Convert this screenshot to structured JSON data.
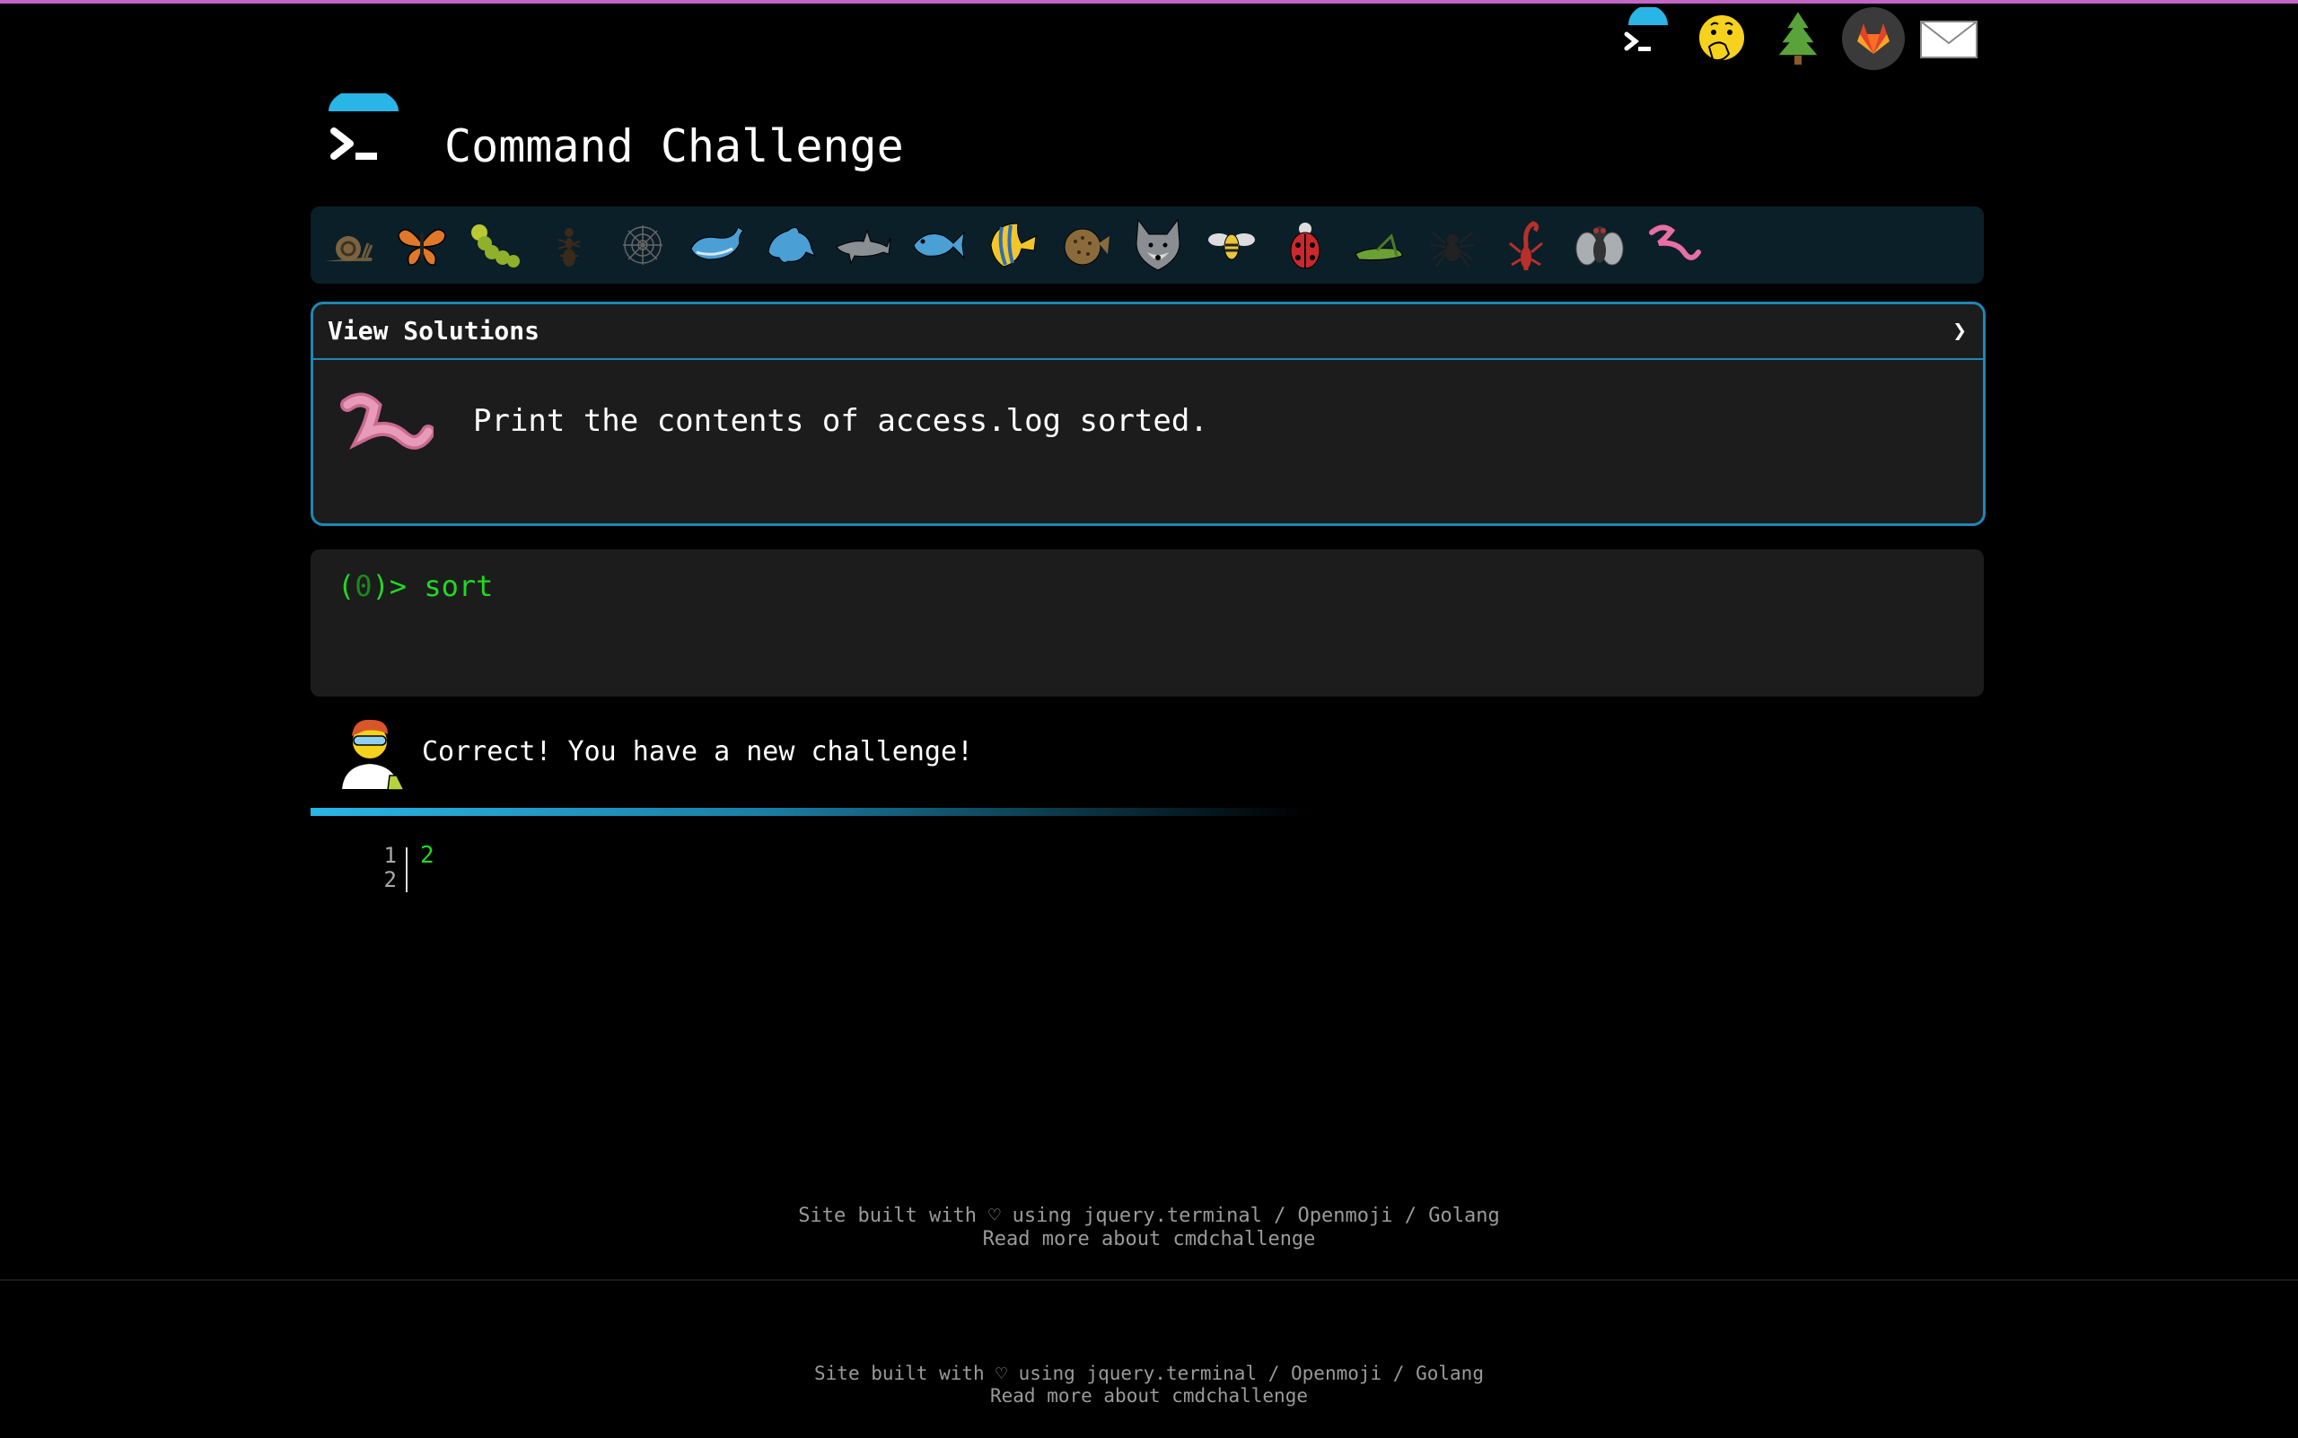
{
  "header": {
    "title": "Command Challenge",
    "logo_icon": "terminal-prompt-icon"
  },
  "top_icons": [
    "terminal-icon",
    "face-with-hand-over-mouth-icon",
    "evergreen-tree-icon",
    "gitlab-icon",
    "envelope-icon"
  ],
  "level_icons": [
    "snail",
    "butterfly",
    "caterpillar",
    "ant",
    "spider-web",
    "whale",
    "dolphin",
    "shark",
    "fish",
    "tropical-fish",
    "blowfish",
    "wolf",
    "bee",
    "ladybug",
    "cricket",
    "spider",
    "scorpion",
    "fly",
    "worm"
  ],
  "challenge": {
    "view_solutions_label": "View Solutions",
    "chevron": "❯",
    "task": "Print the contents of access.log sorted."
  },
  "terminal": {
    "prompt_open": "(",
    "prompt_code": "0",
    "prompt_close": ")>",
    "command": "sort"
  },
  "result": {
    "message": "Correct! You have a new challenge!"
  },
  "output": {
    "line_numbers": [
      "1",
      "2"
    ],
    "lines": [
      "2"
    ]
  },
  "footer": {
    "line1": "Site built with ♡ using jquery.terminal / Openmoji / Golang",
    "line2": "Read more about cmdchallenge"
  },
  "footer_bottom": {
    "line1": "Site built with ♡ using jquery.terminal / Openmoji / Golang",
    "line2": "Read more about cmdchallenge"
  },
  "colors": {
    "background": "#000000",
    "accent_blue": "#1f87b5",
    "prompt_green": "#22d722",
    "panel_bg": "#1c1c1c",
    "strip_bg": "#0b1f29",
    "top_line": "#c267c6"
  }
}
